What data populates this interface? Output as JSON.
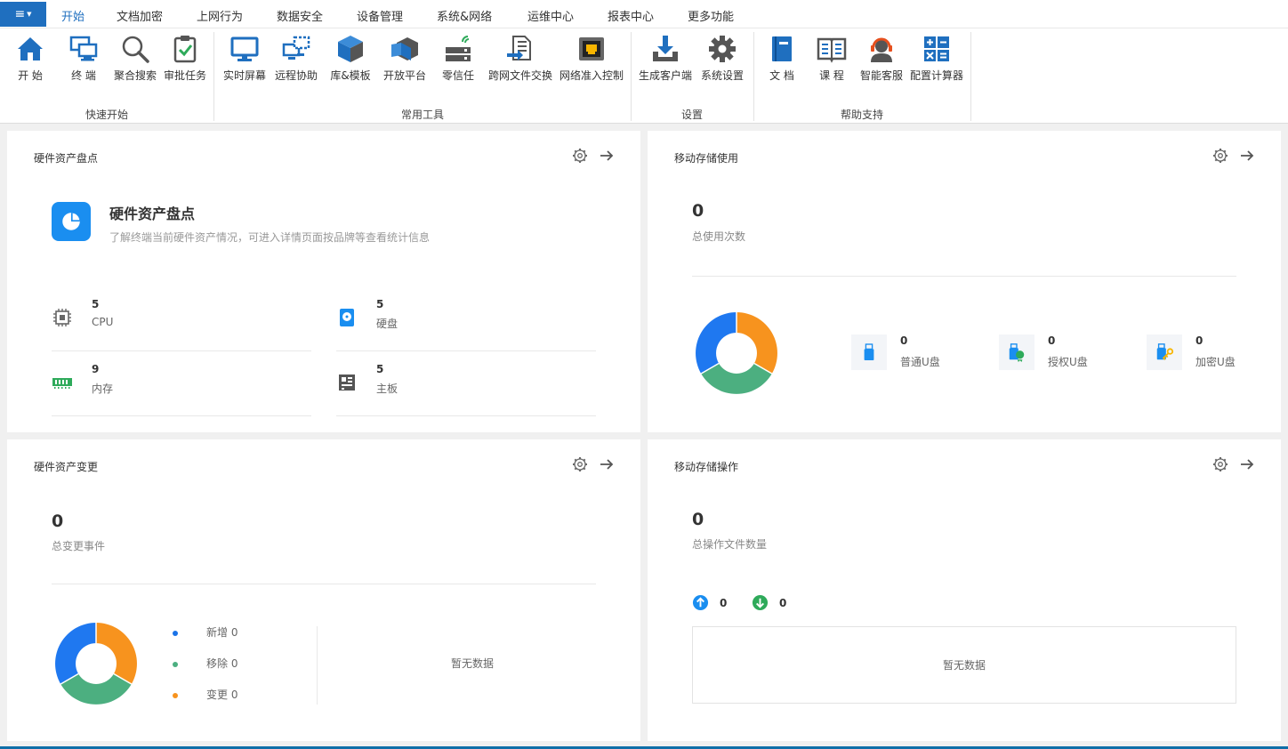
{
  "menu": {
    "app_glyph": "≡",
    "tabs": [
      {
        "label": "开始",
        "active": true
      },
      {
        "label": "文档加密"
      },
      {
        "label": "上网行为"
      },
      {
        "label": "数据安全"
      },
      {
        "label": "设备管理"
      },
      {
        "label": "系统&网络"
      },
      {
        "label": "运维中心"
      },
      {
        "label": "报表中心"
      },
      {
        "label": "更多功能"
      }
    ]
  },
  "ribbon": {
    "groups": [
      "快速开始",
      "常用工具",
      "设置",
      "帮助支持"
    ],
    "items": [
      {
        "label": "开 始",
        "icon": "home-icon"
      },
      {
        "label": "终 端",
        "icon": "terminal-icon"
      },
      {
        "label": "聚合搜索",
        "icon": "search-icon"
      },
      {
        "label": "审批任务",
        "icon": "approval-icon"
      },
      {
        "label": "实时屏幕",
        "icon": "monitor-icon"
      },
      {
        "label": "远程协助",
        "icon": "remote-icon"
      },
      {
        "label": "库&模板",
        "icon": "cube-icon"
      },
      {
        "label": "开放平台",
        "icon": "platform-icon"
      },
      {
        "label": "零信任",
        "icon": "server-icon"
      },
      {
        "label": "跨网文件交换",
        "icon": "file-exchange-icon"
      },
      {
        "label": "网络准入控制",
        "icon": "network-port-icon"
      },
      {
        "label": "生成客户端",
        "icon": "download-icon"
      },
      {
        "label": "系统设置",
        "icon": "gear-icon"
      },
      {
        "label": "文 档",
        "icon": "book-icon"
      },
      {
        "label": "课 程",
        "icon": "course-icon"
      },
      {
        "label": "智能客服",
        "icon": "headset-icon"
      },
      {
        "label": "配置计算器",
        "icon": "calculator-icon"
      }
    ]
  },
  "hw_inventory": {
    "title": "硬件资产盘点",
    "hero_title": "硬件资产盘点",
    "hero_desc": "了解终端当前硬件资产情况，可进入详情页面按品牌等查看统计信息",
    "stats": [
      {
        "value": "5",
        "name": "CPU",
        "icon": "cpu-icon"
      },
      {
        "value": "5",
        "name": "硬盘",
        "icon": "disk-icon"
      },
      {
        "value": "9",
        "name": "内存",
        "icon": "memory-icon"
      },
      {
        "value": "5",
        "name": "主板",
        "icon": "motherboard-icon"
      }
    ]
  },
  "usb_usage": {
    "title": "移动存储使用",
    "total": "0",
    "total_label": "总使用次数",
    "types": [
      {
        "value": "0",
        "name": "普通U盘",
        "icon": "usb-icon"
      },
      {
        "value": "0",
        "name": "授权U盘",
        "icon": "usb-authorized-icon"
      },
      {
        "value": "0",
        "name": "加密U盘",
        "icon": "usb-encrypted-icon"
      }
    ]
  },
  "hw_change": {
    "title": "硬件资产变更",
    "total": "0",
    "total_label": "总变更事件",
    "legend": [
      {
        "label": "新增 0",
        "color": "#1a73e8"
      },
      {
        "label": "移除 0",
        "color": "#4caf80"
      },
      {
        "label": "变更 0",
        "color": "#f7931e"
      }
    ],
    "nodata": "暂无数据"
  },
  "usb_ops": {
    "title": "移动存储操作",
    "total": "0",
    "total_label": "总操作文件数量",
    "upload": "0",
    "download": "0",
    "nodata": "暂无数据"
  },
  "colors": {
    "accent": "#1f6fbf",
    "donut_blue": "#1f78f0",
    "donut_green": "#4caf80",
    "donut_orange": "#f7931e"
  }
}
